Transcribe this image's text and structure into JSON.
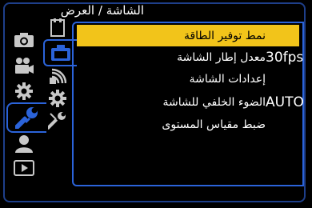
{
  "breadcrumb": "الشاشة / العرض",
  "categories": [
    {
      "icon": "camera-icon"
    },
    {
      "icon": "video-camera-icon"
    },
    {
      "icon": "gear-icon"
    },
    {
      "icon": "wrench-icon",
      "active": true
    },
    {
      "icon": "person-icon"
    },
    {
      "icon": "playback-icon"
    }
  ],
  "subcategories": [
    {
      "icon": "card-icon"
    },
    {
      "icon": "monitor-display-icon",
      "active": true
    },
    {
      "icon": "wireless-icon"
    },
    {
      "icon": "gear-icon"
    },
    {
      "icon": "tools-icon"
    }
  ],
  "menu": {
    "items": [
      {
        "label": "نمط توفير الطاقة",
        "value": "",
        "selected": true
      },
      {
        "label": "معدل إطار الشاشة",
        "value": "30fps"
      },
      {
        "label": "إعدادات الشاشة",
        "value": ""
      },
      {
        "label": "الضوء الخلفي للشاشة",
        "value": "AUTO"
      },
      {
        "label": "ضبط مقياس المستوى",
        "value": ""
      }
    ]
  },
  "colors": {
    "highlight": "#f2c41a",
    "frame": "#2b63d9",
    "icon": "#c8c8c8"
  }
}
